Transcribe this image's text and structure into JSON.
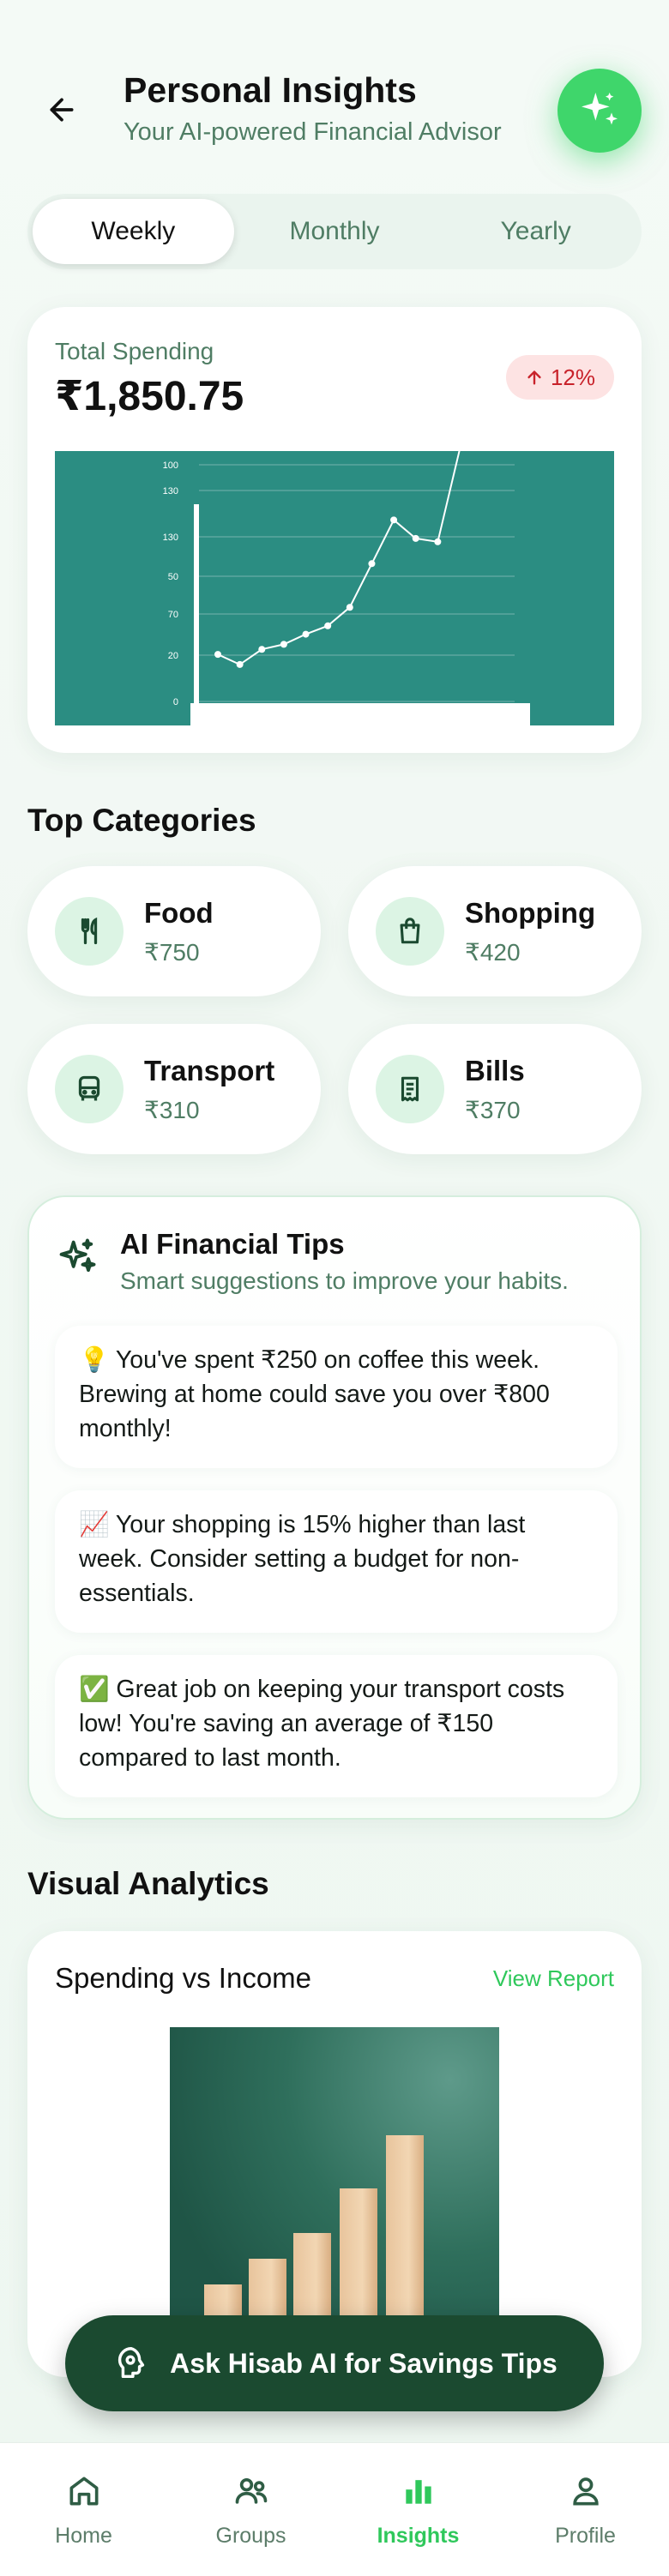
{
  "header": {
    "title": "Personal Insights",
    "subtitle": "Your AI-powered Financial Advisor"
  },
  "period_tabs": [
    {
      "label": "Weekly",
      "active": true
    },
    {
      "label": "Monthly",
      "active": false
    },
    {
      "label": "Yearly",
      "active": false
    }
  ],
  "summary": {
    "label": "Total Spending",
    "value": "₹1,850.75",
    "change": "12%",
    "change_direction": "up",
    "change_color": "#c8222a"
  },
  "chart_data": {
    "type": "line",
    "y_ticks": [
      "100",
      "130",
      "130",
      "50",
      "70",
      "20",
      "0"
    ],
    "values": [
      28,
      22,
      31,
      34,
      40,
      45,
      56,
      82,
      108,
      97,
      95,
      150
    ],
    "line_color": "#ffffff",
    "background_color": "#2b8d82",
    "grid": true
  },
  "categories_section": {
    "title": "Top Categories",
    "items": [
      {
        "name": "Food",
        "value": "₹750",
        "icon": "fork-knife-icon"
      },
      {
        "name": "Shopping",
        "value": "₹420",
        "icon": "shopping-bag-icon"
      },
      {
        "name": "Transport",
        "value": "₹310",
        "icon": "bus-icon"
      },
      {
        "name": "Bills",
        "value": "₹370",
        "icon": "receipt-icon"
      }
    ]
  },
  "tips": {
    "title": "AI Financial Tips",
    "subtitle": "Smart suggestions to improve your habits.",
    "items": [
      "💡 You've spent ₹250 on coffee this week. Brewing at home could save you over ₹800 monthly!",
      "📈 Your shopping is 15% higher than last week. Consider setting a budget for non-essentials.",
      "✅ Great job on keeping your transport costs low! You're saving an average of ₹150 compared to last month."
    ]
  },
  "analytics": {
    "section_title": "Visual Analytics",
    "card_title": "Spending vs Income",
    "link": "View Report"
  },
  "cta": {
    "label": "Ask Hisab AI for Savings Tips"
  },
  "nav": {
    "items": [
      {
        "label": "Home",
        "icon": "home-icon",
        "active": false
      },
      {
        "label": "Groups",
        "icon": "groups-icon",
        "active": false
      },
      {
        "label": "Insights",
        "icon": "bar-chart-icon",
        "active": true
      },
      {
        "label": "Profile",
        "icon": "person-icon",
        "active": false
      }
    ]
  },
  "colors": {
    "accent": "#3fd66b",
    "primary_dark": "#1b4a30",
    "muted_text": "#4f7d64"
  }
}
